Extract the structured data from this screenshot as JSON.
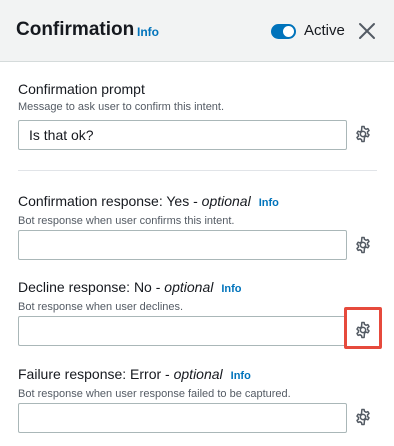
{
  "header": {
    "title": "Confirmation",
    "info": "Info",
    "toggle_label": "Active",
    "toggle_on": true
  },
  "fields": [
    {
      "label": "Confirmation prompt",
      "description": "Message to ask user to confirm this intent.",
      "value": "Is that ok?"
    },
    {
      "label": "Confirmation response: Yes - ",
      "optional": "optional",
      "info": "Info",
      "description": "Bot response when user confirms this intent.",
      "value": ""
    },
    {
      "label": "Decline response: No - ",
      "optional": "optional",
      "info": "Info",
      "description": "Bot response when user declines.",
      "value": ""
    },
    {
      "label": "Failure response: Error - ",
      "optional": "optional",
      "info": "Info",
      "description": "Bot response when user response failed to be captured.",
      "value": ""
    }
  ],
  "colors": {
    "accent": "#0073bb",
    "highlight": "#e64a3c"
  }
}
